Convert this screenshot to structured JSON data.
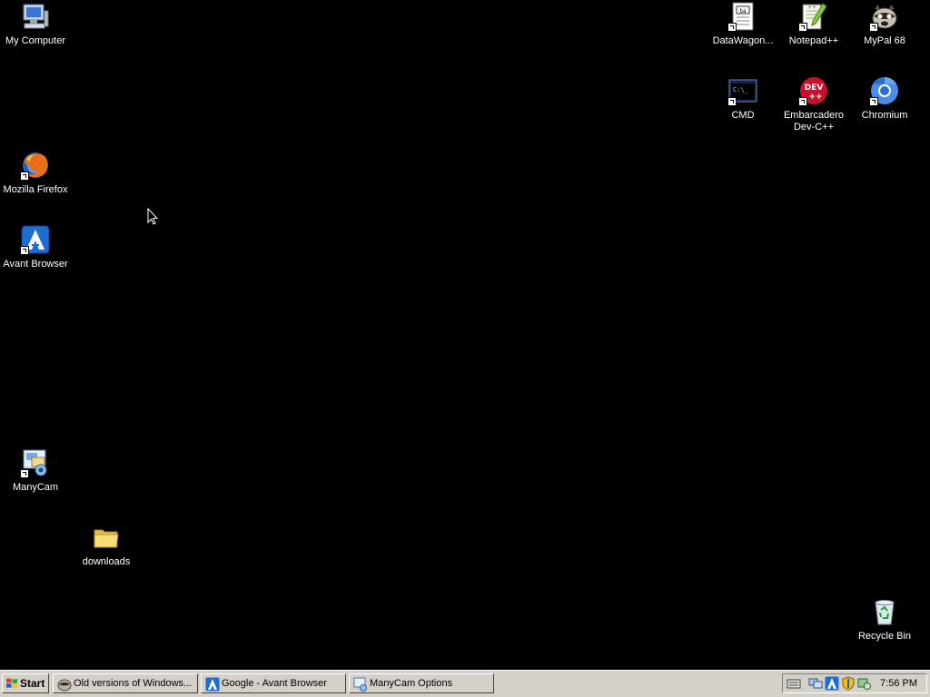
{
  "desktop": {
    "icons": {
      "my_computer": {
        "label": "My Computer",
        "icon": "computer-icon"
      },
      "firefox": {
        "label": "Mozilla Firefox",
        "icon": "firefox-icon"
      },
      "avant": {
        "label": "Avant Browser",
        "icon": "avant-browser-icon"
      },
      "manycam": {
        "label": "ManyCam",
        "icon": "manycam-icon"
      },
      "downloads": {
        "label": "downloads",
        "icon": "folder-icon"
      },
      "datawagon": {
        "label": "DataWagon...",
        "icon": "datawagon-icon"
      },
      "notepadpp": {
        "label": "Notepad++",
        "icon": "notepadpp-icon"
      },
      "mypal": {
        "label": "MyPal 68",
        "icon": "mypal-icon"
      },
      "cmd": {
        "label": "CMD",
        "icon": "cmd-icon"
      },
      "devcpp": {
        "label": "Embarcadero\nDev-C++",
        "icon": "devcpp-icon"
      },
      "chromium": {
        "label": "Chromium",
        "icon": "chromium-icon"
      },
      "recycle_bin": {
        "label": "Recycle Bin",
        "icon": "recycle-bin-icon"
      }
    }
  },
  "taskbar": {
    "start_label": "Start",
    "tasks": [
      {
        "label": "Old versions of Windows...",
        "icon": "mypal-icon"
      },
      {
        "label": "Google - Avant Browser",
        "icon": "avant-browser-icon"
      },
      {
        "label": "ManyCam Options",
        "icon": "manycam-icon"
      }
    ],
    "tray": {
      "icons": [
        "keyboard-icon",
        "network-icon",
        "avant-tray-icon",
        "security-shield-icon",
        "manycam-tray-icon"
      ],
      "clock": "7:56 PM"
    }
  },
  "colors": {
    "desktop_background": "#000000",
    "taskbar": "#d4d0c8",
    "icon_label": "#ffffff"
  }
}
